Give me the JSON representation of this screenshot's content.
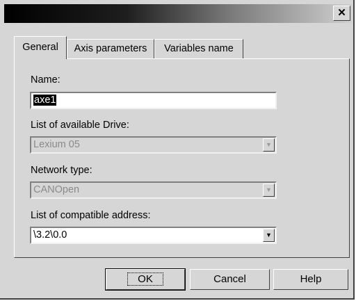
{
  "window": {
    "title": "",
    "close_glyph": "✕"
  },
  "tabs": [
    {
      "label": "General",
      "active": true
    },
    {
      "label": "Axis parameters",
      "active": false
    },
    {
      "label": "Variables name",
      "active": false
    }
  ],
  "general": {
    "name_label": "Name:",
    "name_value": "axe1",
    "drive_label": "List of available Drive:",
    "drive_value": "Lexium 05",
    "network_label": "Network type:",
    "network_value": "CANOpen",
    "address_label": "List of compatible address:",
    "address_value": "\\3.2\\0.0",
    "dropdown_glyph": "▼"
  },
  "buttons": {
    "ok": "OK",
    "cancel": "Cancel",
    "help": "Help"
  }
}
